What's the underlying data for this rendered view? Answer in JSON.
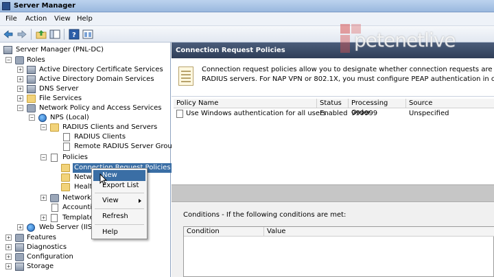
{
  "window": {
    "title": "Server Manager"
  },
  "menubar": [
    "File",
    "Action",
    "View",
    "Help"
  ],
  "tree": {
    "root": "Server Manager (PNL-DC)",
    "roles": "Roles",
    "adcs": "Active Directory Certificate Services",
    "adds": "Active Directory Domain Services",
    "dns": "DNS Server",
    "file": "File Services",
    "npas": "Network Policy and Access Services",
    "nps": "NPS (Local)",
    "radius": "RADIUS Clients and Servers",
    "radius_clients": "RADIUS Clients",
    "remote_groups": "Remote RADIUS Server Groups",
    "policies": "Policies",
    "crp": "Connection Request Policies",
    "netw": "Netw",
    "healt": "Healt",
    "network": "Network",
    "accountin": "Accountin",
    "template": "Template",
    "web": "Web Server (IIS)",
    "features": "Features",
    "diagnostics": "Diagnostics",
    "configuration": "Configuration",
    "storage": "Storage"
  },
  "pane": {
    "header": "Connection Request Policies",
    "info_line1": "Connection request policies allow you to designate whether connection requests are processed local",
    "info_line2": "RADIUS servers. For NAP VPN or 802.1X, you must configure PEAP authentication in connection re"
  },
  "grid": {
    "columns": [
      "Policy Name",
      "Status",
      "Processing Order",
      "Source"
    ],
    "rows": [
      {
        "name": "Use Windows authentication for all users",
        "status": "Enabled",
        "order": "999999",
        "source": "Unspecified"
      }
    ]
  },
  "conditions": {
    "label": "Conditions - If the following conditions are met:",
    "columns": [
      "Condition",
      "Value"
    ]
  },
  "context_menu": {
    "new": "New",
    "export": "Export List",
    "view": "View",
    "refresh": "Refresh",
    "help": "Help"
  },
  "watermark": "petenetlive",
  "colors": {
    "selection": "#3a6ea5",
    "header_bg": "#2f3e58"
  }
}
